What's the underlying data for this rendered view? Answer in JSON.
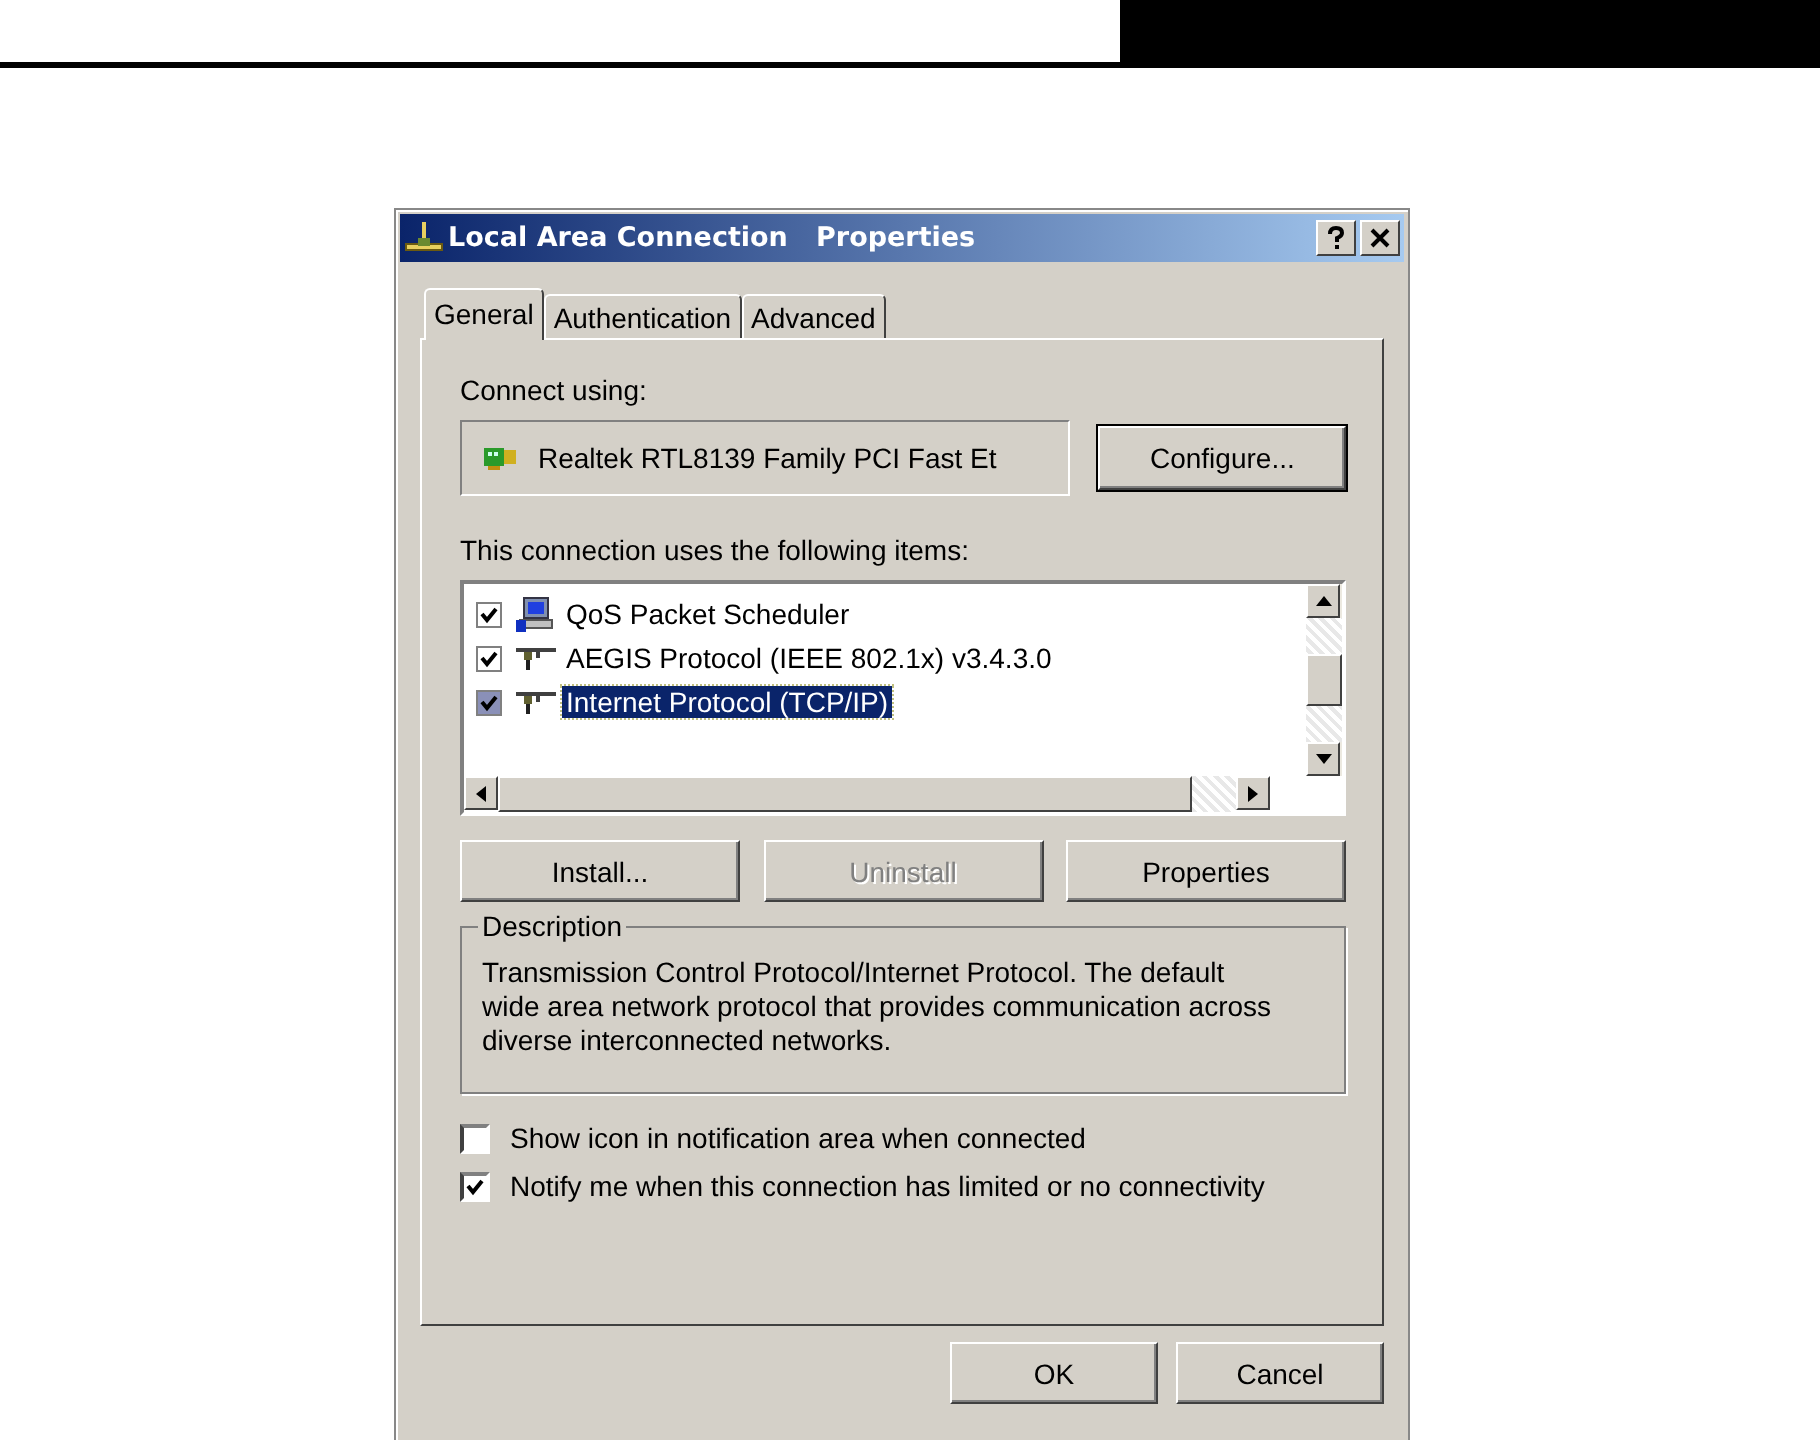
{
  "window": {
    "title": "Local Area Connection   Properties"
  },
  "tabs": [
    {
      "label": "General",
      "selected": true
    },
    {
      "label": "Authentication",
      "selected": false
    },
    {
      "label": "Advanced",
      "selected": false
    }
  ],
  "connect_using": {
    "label": "Connect using:",
    "adapter": "Realtek RTL8139 Family PCI Fast Et",
    "button": "Configure..."
  },
  "items_label": "This connection uses the following items:",
  "items": [
    {
      "name": "QoS Packet Scheduler",
      "checked": true,
      "selected": false,
      "kind": "service"
    },
    {
      "name": "AEGIS Protocol (IEEE 802.1x) v3.4.3.0",
      "checked": true,
      "selected": false,
      "kind": "protocol"
    },
    {
      "name": "Internet Protocol (TCP/IP)",
      "checked": true,
      "selected": true,
      "kind": "protocol"
    }
  ],
  "item_buttons": [
    {
      "label": "Install...",
      "disabled": false
    },
    {
      "label": "Uninstall",
      "disabled": true
    },
    {
      "label": "Properties",
      "disabled": false
    }
  ],
  "description": {
    "title": "Description",
    "text": "Transmission Control Protocol/Internet Protocol. The default wide area network protocol that provides communication across diverse interconnected networks."
  },
  "options": [
    {
      "label": "Show icon in notification area when connected",
      "checked": false
    },
    {
      "label": "Notify me when this connection has limited or no connectivity",
      "checked": true
    }
  ],
  "buttons": [
    {
      "label": "OK"
    },
    {
      "label": "Cancel"
    }
  ]
}
